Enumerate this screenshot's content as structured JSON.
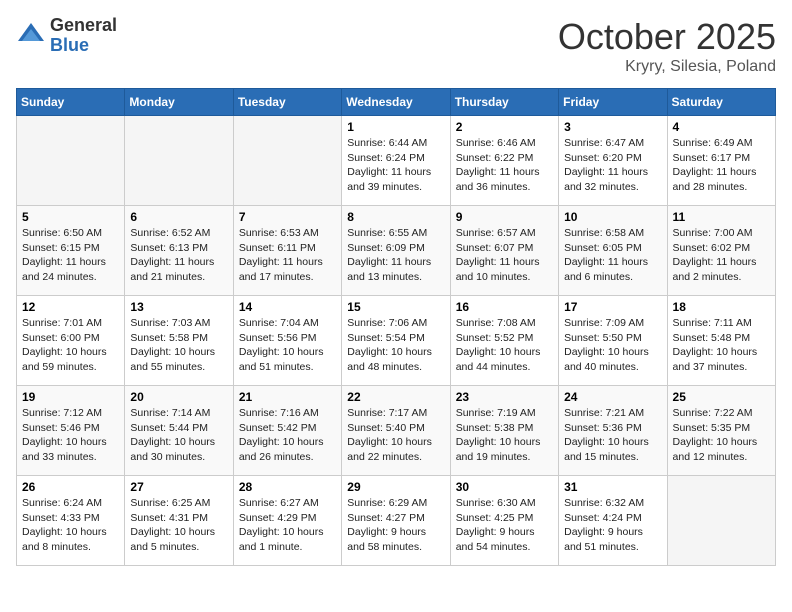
{
  "logo": {
    "general": "General",
    "blue": "Blue"
  },
  "title": "October 2025",
  "location": "Kryry, Silesia, Poland",
  "days_of_week": [
    "Sunday",
    "Monday",
    "Tuesday",
    "Wednesday",
    "Thursday",
    "Friday",
    "Saturday"
  ],
  "weeks": [
    [
      {
        "day": "",
        "info": ""
      },
      {
        "day": "",
        "info": ""
      },
      {
        "day": "",
        "info": ""
      },
      {
        "day": "1",
        "info": "Sunrise: 6:44 AM\nSunset: 6:24 PM\nDaylight: 11 hours\nand 39 minutes."
      },
      {
        "day": "2",
        "info": "Sunrise: 6:46 AM\nSunset: 6:22 PM\nDaylight: 11 hours\nand 36 minutes."
      },
      {
        "day": "3",
        "info": "Sunrise: 6:47 AM\nSunset: 6:20 PM\nDaylight: 11 hours\nand 32 minutes."
      },
      {
        "day": "4",
        "info": "Sunrise: 6:49 AM\nSunset: 6:17 PM\nDaylight: 11 hours\nand 28 minutes."
      }
    ],
    [
      {
        "day": "5",
        "info": "Sunrise: 6:50 AM\nSunset: 6:15 PM\nDaylight: 11 hours\nand 24 minutes."
      },
      {
        "day": "6",
        "info": "Sunrise: 6:52 AM\nSunset: 6:13 PM\nDaylight: 11 hours\nand 21 minutes."
      },
      {
        "day": "7",
        "info": "Sunrise: 6:53 AM\nSunset: 6:11 PM\nDaylight: 11 hours\nand 17 minutes."
      },
      {
        "day": "8",
        "info": "Sunrise: 6:55 AM\nSunset: 6:09 PM\nDaylight: 11 hours\nand 13 minutes."
      },
      {
        "day": "9",
        "info": "Sunrise: 6:57 AM\nSunset: 6:07 PM\nDaylight: 11 hours\nand 10 minutes."
      },
      {
        "day": "10",
        "info": "Sunrise: 6:58 AM\nSunset: 6:05 PM\nDaylight: 11 hours\nand 6 minutes."
      },
      {
        "day": "11",
        "info": "Sunrise: 7:00 AM\nSunset: 6:02 PM\nDaylight: 11 hours\nand 2 minutes."
      }
    ],
    [
      {
        "day": "12",
        "info": "Sunrise: 7:01 AM\nSunset: 6:00 PM\nDaylight: 10 hours\nand 59 minutes."
      },
      {
        "day": "13",
        "info": "Sunrise: 7:03 AM\nSunset: 5:58 PM\nDaylight: 10 hours\nand 55 minutes."
      },
      {
        "day": "14",
        "info": "Sunrise: 7:04 AM\nSunset: 5:56 PM\nDaylight: 10 hours\nand 51 minutes."
      },
      {
        "day": "15",
        "info": "Sunrise: 7:06 AM\nSunset: 5:54 PM\nDaylight: 10 hours\nand 48 minutes."
      },
      {
        "day": "16",
        "info": "Sunrise: 7:08 AM\nSunset: 5:52 PM\nDaylight: 10 hours\nand 44 minutes."
      },
      {
        "day": "17",
        "info": "Sunrise: 7:09 AM\nSunset: 5:50 PM\nDaylight: 10 hours\nand 40 minutes."
      },
      {
        "day": "18",
        "info": "Sunrise: 7:11 AM\nSunset: 5:48 PM\nDaylight: 10 hours\nand 37 minutes."
      }
    ],
    [
      {
        "day": "19",
        "info": "Sunrise: 7:12 AM\nSunset: 5:46 PM\nDaylight: 10 hours\nand 33 minutes."
      },
      {
        "day": "20",
        "info": "Sunrise: 7:14 AM\nSunset: 5:44 PM\nDaylight: 10 hours\nand 30 minutes."
      },
      {
        "day": "21",
        "info": "Sunrise: 7:16 AM\nSunset: 5:42 PM\nDaylight: 10 hours\nand 26 minutes."
      },
      {
        "day": "22",
        "info": "Sunrise: 7:17 AM\nSunset: 5:40 PM\nDaylight: 10 hours\nand 22 minutes."
      },
      {
        "day": "23",
        "info": "Sunrise: 7:19 AM\nSunset: 5:38 PM\nDaylight: 10 hours\nand 19 minutes."
      },
      {
        "day": "24",
        "info": "Sunrise: 7:21 AM\nSunset: 5:36 PM\nDaylight: 10 hours\nand 15 minutes."
      },
      {
        "day": "25",
        "info": "Sunrise: 7:22 AM\nSunset: 5:35 PM\nDaylight: 10 hours\nand 12 minutes."
      }
    ],
    [
      {
        "day": "26",
        "info": "Sunrise: 6:24 AM\nSunset: 4:33 PM\nDaylight: 10 hours\nand 8 minutes."
      },
      {
        "day": "27",
        "info": "Sunrise: 6:25 AM\nSunset: 4:31 PM\nDaylight: 10 hours\nand 5 minutes."
      },
      {
        "day": "28",
        "info": "Sunrise: 6:27 AM\nSunset: 4:29 PM\nDaylight: 10 hours\nand 1 minute."
      },
      {
        "day": "29",
        "info": "Sunrise: 6:29 AM\nSunset: 4:27 PM\nDaylight: 9 hours\nand 58 minutes."
      },
      {
        "day": "30",
        "info": "Sunrise: 6:30 AM\nSunset: 4:25 PM\nDaylight: 9 hours\nand 54 minutes."
      },
      {
        "day": "31",
        "info": "Sunrise: 6:32 AM\nSunset: 4:24 PM\nDaylight: 9 hours\nand 51 minutes."
      },
      {
        "day": "",
        "info": ""
      }
    ]
  ]
}
